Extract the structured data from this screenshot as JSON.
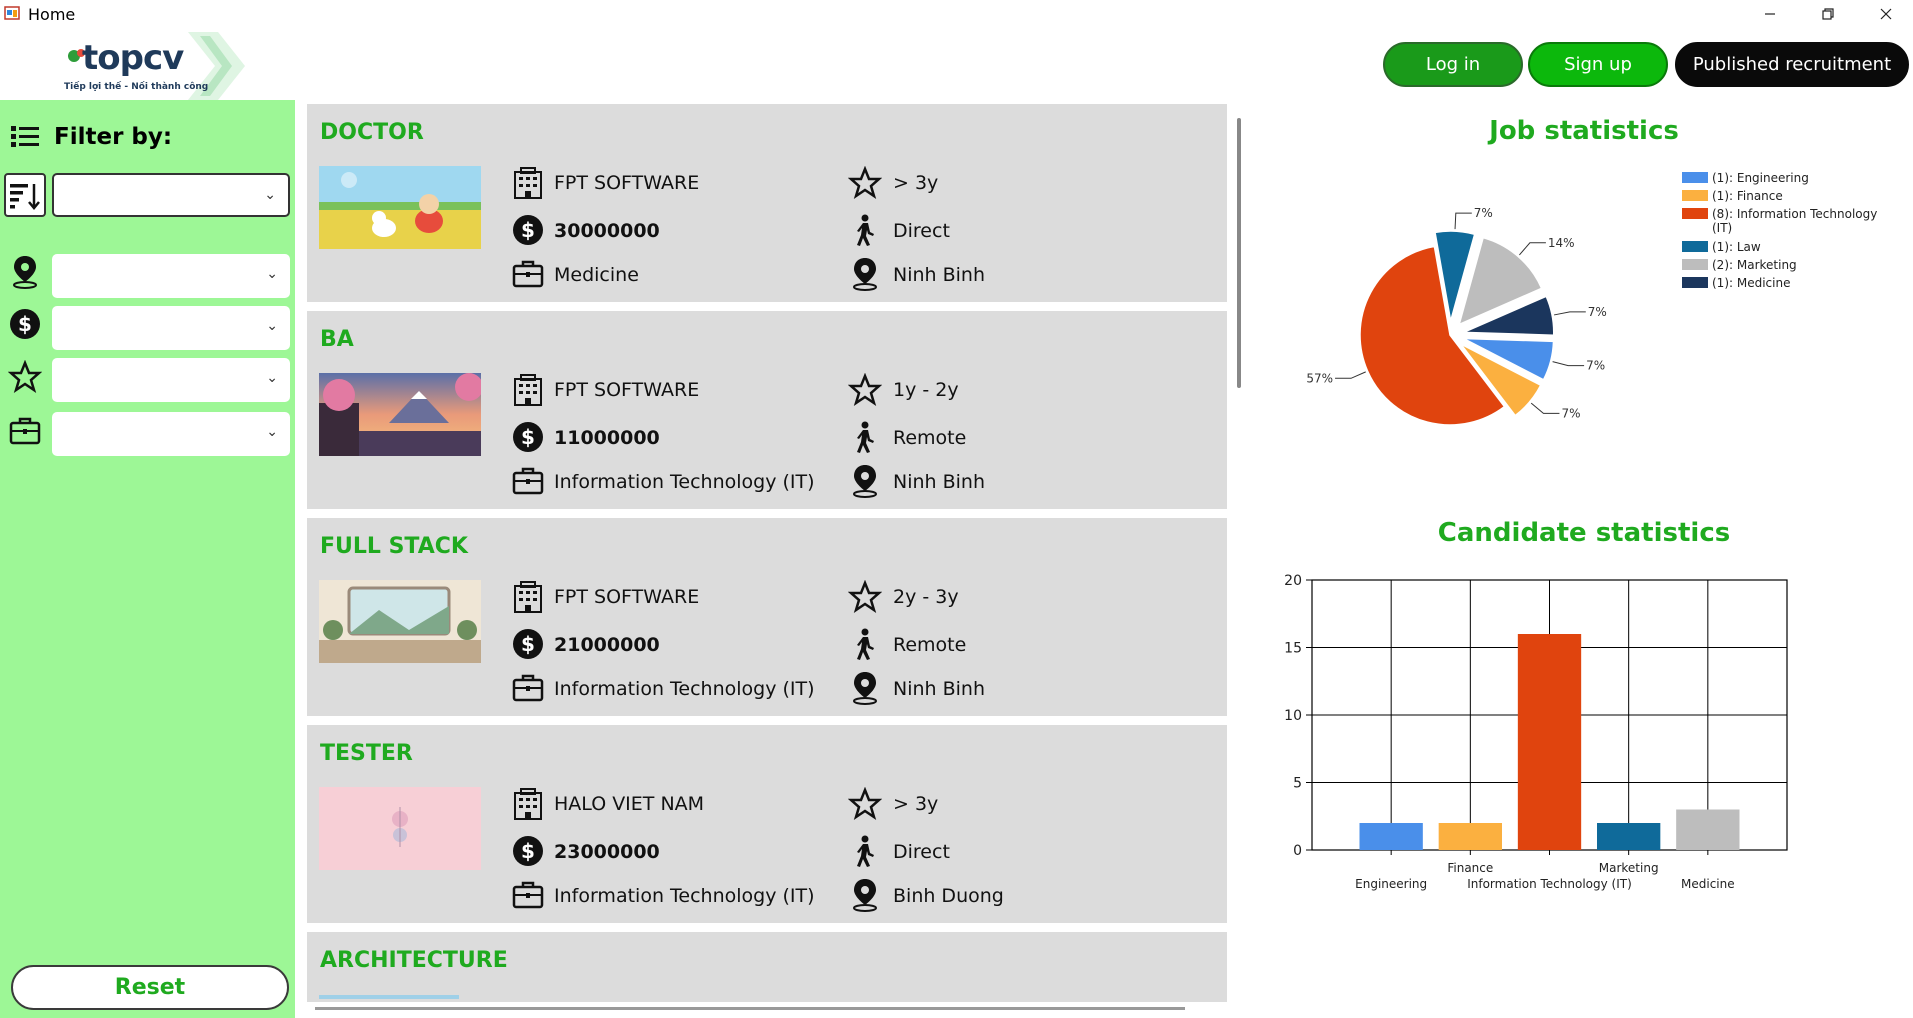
{
  "window": {
    "title": "Home"
  },
  "header": {
    "logo_text": "topcv",
    "logo_tagline": "Tiếp lợi thế - Nối thành công",
    "login_label": "Log in",
    "signup_label": "Sign up",
    "publish_label": "Published recruitment",
    "login_color": "#1a9a1a",
    "signup_color": "#0cb80c",
    "publish_color": "#0a0a0a"
  },
  "sidebar": {
    "filter_title": "Filter by:",
    "sort_value": "",
    "location_value": "",
    "salary_value": "",
    "experience_value": "",
    "field_value": "",
    "reset_label": "Reset"
  },
  "jobs": [
    {
      "title": "DOCTOR",
      "company": "FPT SOFTWARE",
      "salary": "30000000",
      "field": "Medicine",
      "experience": "> 3y",
      "work_type": "Direct",
      "location": "Ninh Binh"
    },
    {
      "title": "BA",
      "company": "FPT SOFTWARE",
      "salary": "11000000",
      "field": "Information Technology (IT)",
      "experience": "1y - 2y",
      "work_type": "Remote",
      "location": "Ninh Binh"
    },
    {
      "title": "FULL STACK",
      "company": "FPT SOFTWARE",
      "salary": "21000000",
      "field": "Information Technology (IT)",
      "experience": "2y - 3y",
      "work_type": "Remote",
      "location": "Ninh Binh"
    },
    {
      "title": "TESTER",
      "company": "HALO VIET NAM",
      "salary": "23000000",
      "field": "Information Technology (IT)",
      "experience": "> 3y",
      "work_type": "Direct",
      "location": "Binh Duong"
    },
    {
      "title": "ARCHITECTURE"
    }
  ],
  "chart_data": [
    {
      "type": "pie",
      "title": "Job statistics",
      "legend_position": "top-right",
      "slices": [
        {
          "label": "(1): Engineering",
          "value": 7,
          "display": "7%",
          "color": "#4a8fea"
        },
        {
          "label": "(1): Finance",
          "value": 7,
          "display": "7%",
          "color": "#fbb040"
        },
        {
          "label": "(8): Information Technology (IT)",
          "value": 57,
          "display": "57%",
          "color": "#e0440e"
        },
        {
          "label": "(1): Law",
          "value": 7,
          "display": "7%",
          "color": "#0f6a9a"
        },
        {
          "label": "(2): Marketing",
          "value": 14,
          "display": "14%",
          "color": "#bdbdbd"
        },
        {
          "label": "(1): Medicine",
          "value": 7,
          "display": "7%",
          "color": "#1b365d"
        }
      ]
    },
    {
      "type": "bar",
      "title": "Candidate statistics",
      "categories": [
        "Engineering",
        "Finance",
        "Information Technology (IT)",
        "Marketing",
        "Medicine"
      ],
      "values": [
        2,
        2,
        16,
        2,
        3
      ],
      "colors": [
        "#4a8fea",
        "#fbb040",
        "#e0440e",
        "#0f6a9a",
        "#bdbdbd"
      ],
      "ylim": [
        0,
        20
      ],
      "yticks": [
        "0",
        "5",
        "10",
        "15",
        "20"
      ],
      "grid": true
    }
  ]
}
